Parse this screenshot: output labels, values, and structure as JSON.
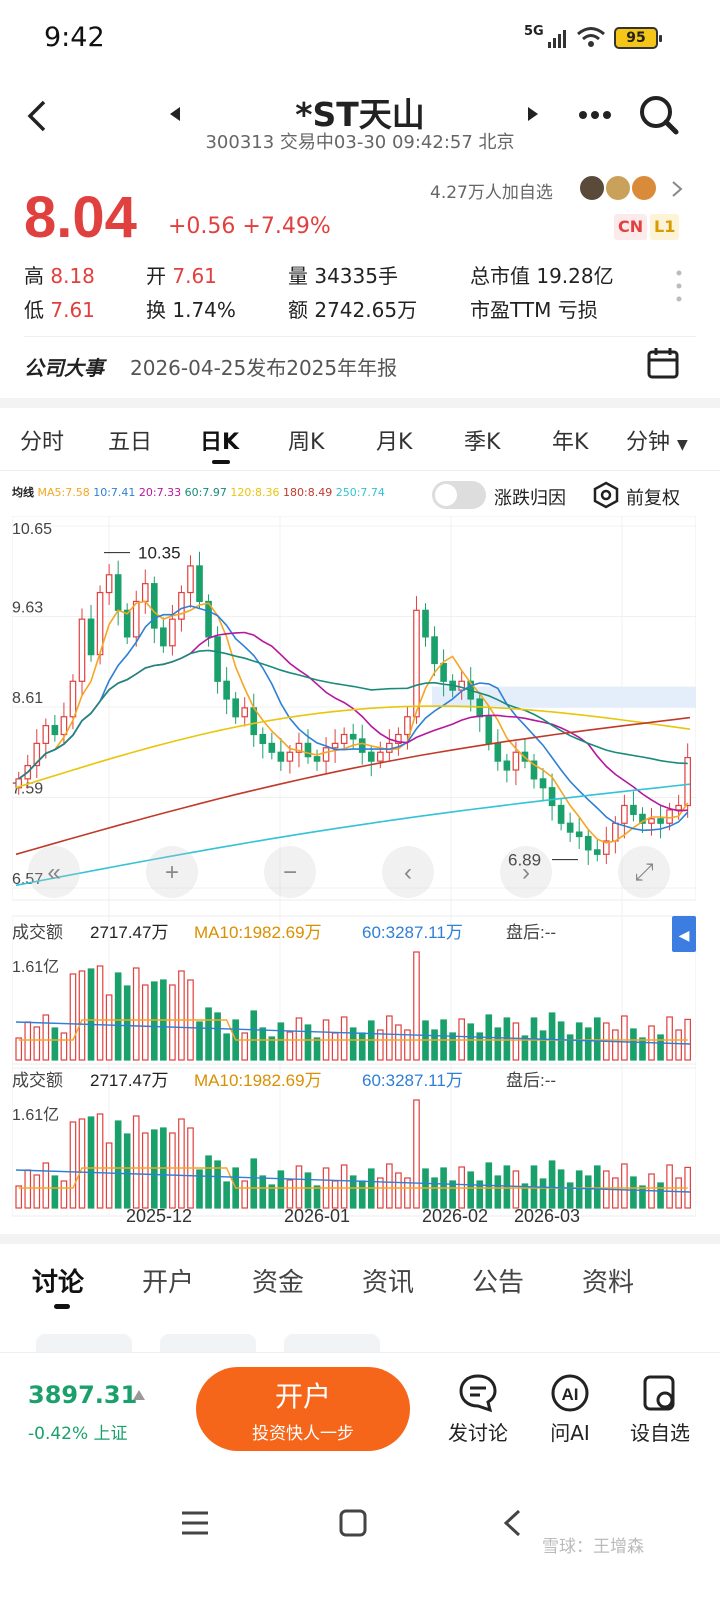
{
  "status": {
    "time": "9:42",
    "network": "5G",
    "battery": "95"
  },
  "header": {
    "title": "*ST天山",
    "code": "300313",
    "status_text": "交易中03-30 09:42:57 北京"
  },
  "quote": {
    "price": "8.04",
    "change": "+0.56",
    "change_pct": "+7.49%",
    "watchers": "4.27万人加自选",
    "badge_cn": "CN",
    "badge_l1": "L1",
    "high_label": "高",
    "high": "8.18",
    "low_label": "低",
    "low": "7.61",
    "open_label": "开",
    "open": "7.61",
    "turnover_label": "换",
    "turnover": "1.74%",
    "volume_label": "量",
    "volume": "34335手",
    "amount_label": "额",
    "amount": "2742.65万",
    "mcap_label": "总市值",
    "mcap": "19.28亿",
    "pe_label": "市盈TTM",
    "pe": "亏损"
  },
  "event": {
    "label": "公司大事",
    "text": "2026-04-25发布2025年年报"
  },
  "period_tabs": [
    "分时",
    "五日",
    "日K",
    "周K",
    "月K",
    "季K",
    "年K",
    "分钟"
  ],
  "ma_legend": {
    "label": "均线",
    "items": [
      {
        "text": "MA5:7.58",
        "color": "#f5a623"
      },
      {
        "text": "10:7.41",
        "color": "#2e7fd6"
      },
      {
        "text": "20:7.33",
        "color": "#b5179e"
      },
      {
        "text": "60:7.97",
        "color": "#1a8a7a"
      },
      {
        "text": "120:8.36",
        "color": "#e8c60d"
      },
      {
        "text": "180:8.49",
        "color": "#c0392b"
      },
      {
        "text": "250:7.74",
        "color": "#33c2d6"
      }
    ],
    "toggle_label": "涨跌归因",
    "adjust_label": "前复权"
  },
  "chart_data": {
    "type": "candlestick",
    "y_ticks": [
      "10.65",
      "9.63",
      "8.61",
      "7.59",
      "6.57"
    ],
    "ylim": [
      6.57,
      10.65
    ],
    "high_marker": "10.35",
    "low_marker": "6.89",
    "x_ticks": [
      "2025-12",
      "2026-01",
      "2026-02",
      "2026-03"
    ],
    "closes": [
      7.8,
      7.95,
      8.2,
      8.4,
      8.3,
      8.5,
      8.9,
      9.6,
      9.2,
      9.9,
      10.1,
      9.7,
      9.4,
      9.8,
      10.0,
      9.5,
      9.3,
      9.6,
      9.9,
      10.2,
      9.8,
      9.4,
      8.9,
      8.7,
      8.5,
      8.6,
      8.3,
      8.2,
      8.1,
      8.0,
      8.1,
      8.2,
      8.05,
      8.0,
      8.15,
      8.2,
      8.3,
      8.25,
      8.1,
      8.0,
      8.1,
      8.2,
      8.3,
      8.5,
      9.7,
      9.4,
      9.1,
      8.9,
      8.8,
      8.9,
      8.7,
      8.5,
      8.2,
      8.0,
      7.9,
      8.1,
      8.0,
      7.8,
      7.7,
      7.5,
      7.3,
      7.2,
      7.15,
      7.0,
      6.95,
      7.1,
      7.3,
      7.5,
      7.4,
      7.3,
      7.35,
      7.3,
      7.45,
      7.5,
      8.04
    ],
    "volume_label": "成交额",
    "volume_value": "2717.47万",
    "volume_ma10": "MA10:1982.69万",
    "volume_ma60": "60:3287.11万",
    "volume_after": "盘后:--",
    "volume_max": "1.61亿"
  },
  "bottom_tabs": [
    "讨论",
    "开户",
    "资金",
    "资讯",
    "公告",
    "资料"
  ],
  "footer": {
    "index_value": "3897.31",
    "index_change": "-0.42% 上证",
    "cta_title": "开户",
    "cta_sub": "投资快人一步",
    "discuss": "发讨论",
    "ask_ai": "问AI",
    "watchlist": "设自选"
  },
  "watermark": "雪球：王增森",
  "colors": {
    "up": "#e0403e",
    "down": "#1aa06b",
    "accent": "#f5661b"
  }
}
